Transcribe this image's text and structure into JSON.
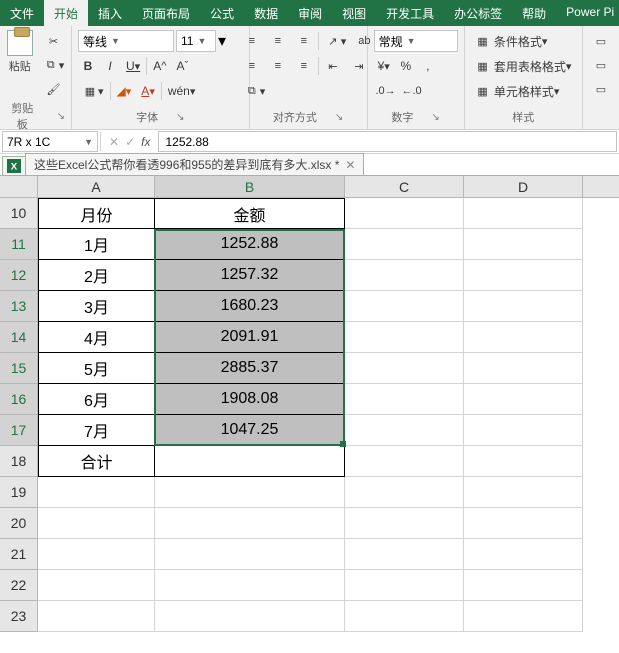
{
  "tabs": {
    "file": "文件",
    "home": "开始",
    "insert": "插入",
    "layout": "页面布局",
    "formulas": "公式",
    "data": "数据",
    "review": "审阅",
    "view": "视图",
    "dev": "开发工具",
    "office": "办公标签",
    "help": "帮助",
    "powerp": "Power Pi"
  },
  "ribbon": {
    "clipboard": {
      "paste": "粘贴",
      "label": "剪贴板"
    },
    "font": {
      "name": "等线",
      "size": "11",
      "bold": "B",
      "italic": "I",
      "underline": "U",
      "wen": "wén",
      "label": "字体"
    },
    "align": {
      "label": "对齐方式"
    },
    "number": {
      "format": "常规",
      "label": "数字"
    },
    "styles": {
      "cond": "条件格式",
      "table": "套用表格格式",
      "cell": "单元格样式",
      "label": "样式"
    }
  },
  "namebox": "7R x 1C",
  "formula": "1252.88",
  "workbook": {
    "filename": "这些Excel公式帮你看透996和955的差异到底有多大.xlsx *"
  },
  "columns": [
    "A",
    "B",
    "C",
    "D"
  ],
  "row_start": 10,
  "table": {
    "header": {
      "A": "月份",
      "B": "金额"
    },
    "rows": [
      {
        "A": "1月",
        "B": "1252.88"
      },
      {
        "A": "2月",
        "B": "1257.32"
      },
      {
        "A": "3月",
        "B": "1680.23"
      },
      {
        "A": "4月",
        "B": "2091.91"
      },
      {
        "A": "5月",
        "B": "2885.37"
      },
      {
        "A": "6月",
        "B": "1908.08"
      },
      {
        "A": "7月",
        "B": "1047.25"
      }
    ],
    "footer": {
      "A": "合计",
      "B": ""
    }
  }
}
